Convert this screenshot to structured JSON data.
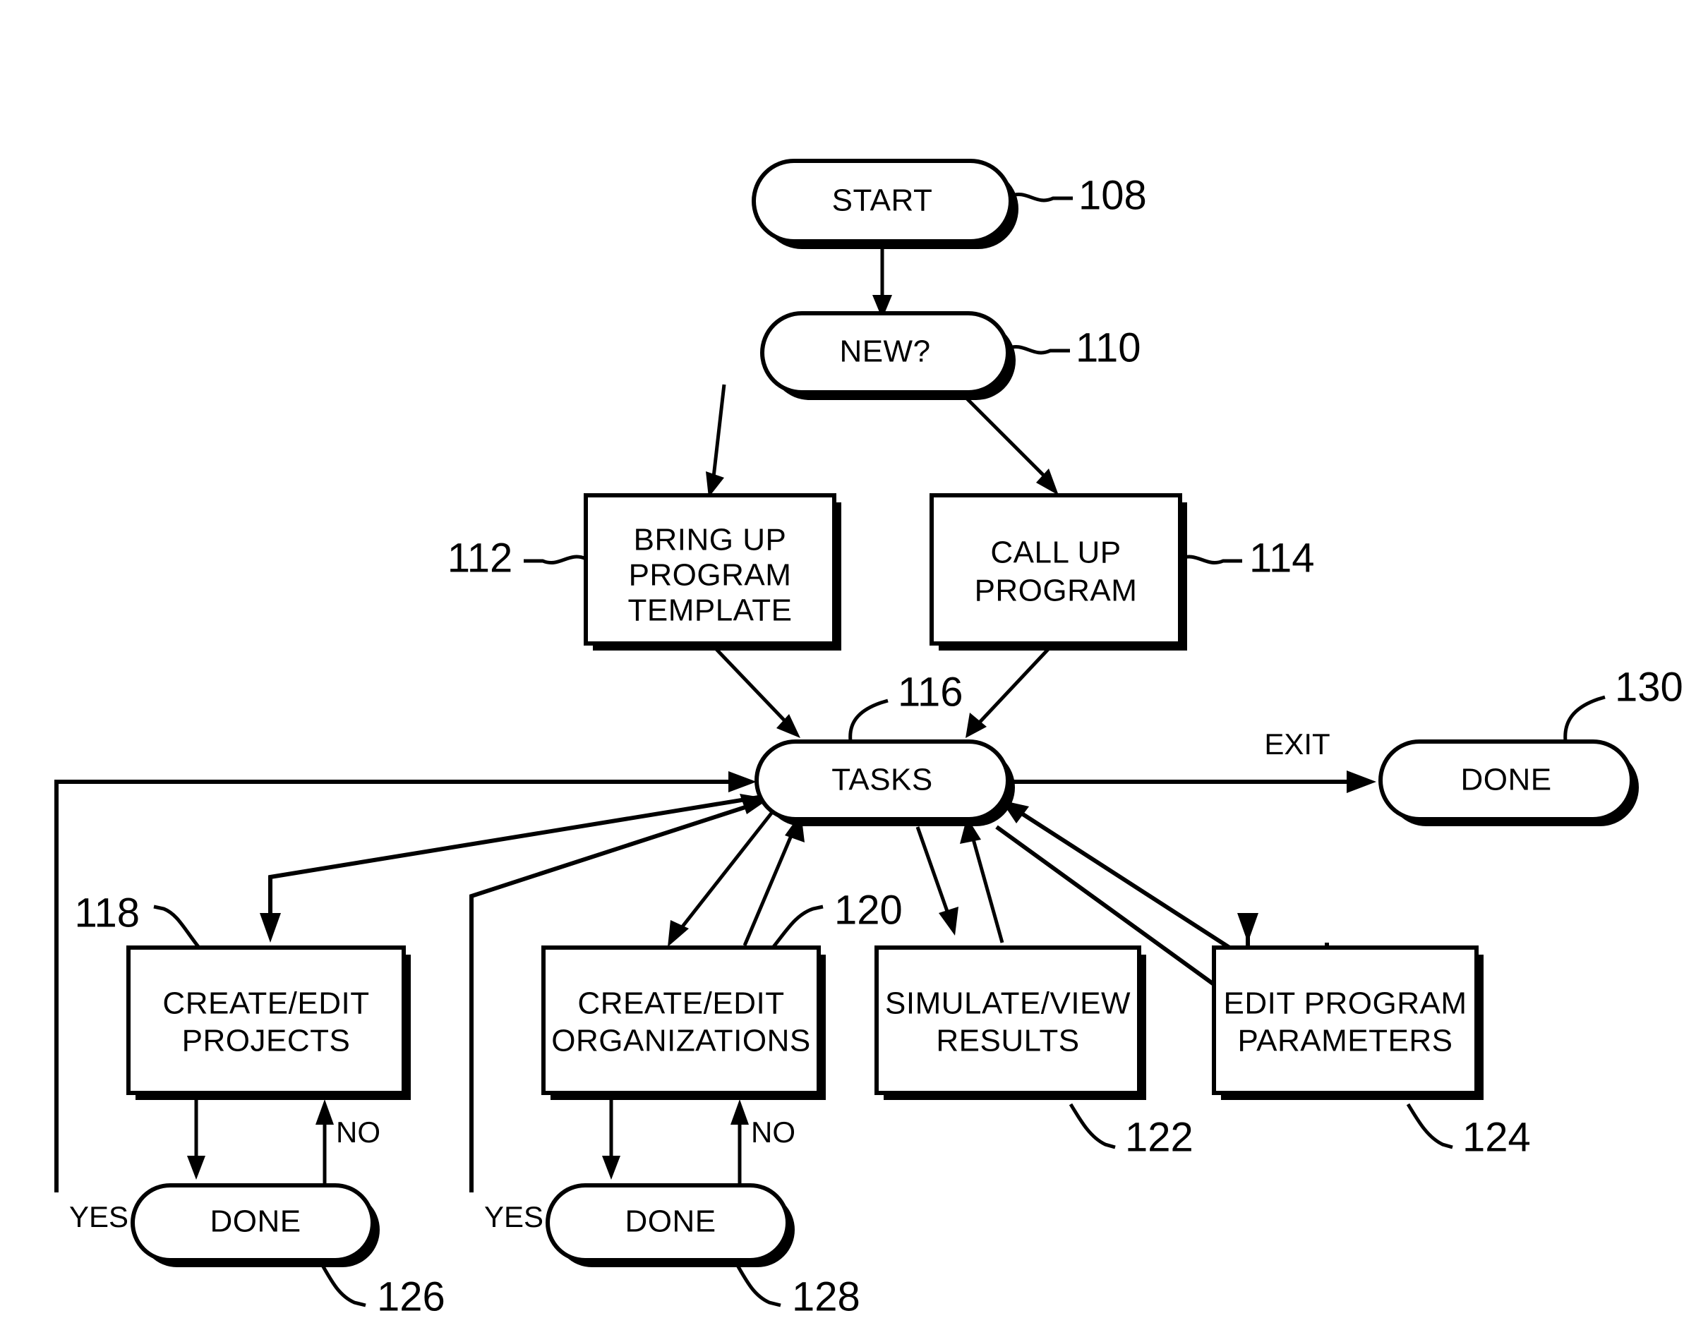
{
  "diagram": {
    "title": "Program workflow flowchart",
    "background_color": "#ffffff",
    "line_color": "#000000"
  },
  "nodes": {
    "start": {
      "label": "START",
      "ref": "108",
      "shape": "stadium"
    },
    "new": {
      "label": "NEW?",
      "ref": "110",
      "shape": "stadium"
    },
    "bring_up": {
      "label_l1": "BRING UP",
      "label_l2": "PROGRAM",
      "label_l3": "TEMPLATE",
      "ref": "112",
      "shape": "rect"
    },
    "call_up": {
      "label_l1": "CALL UP",
      "label_l2": "PROGRAM",
      "ref": "114",
      "shape": "rect"
    },
    "tasks": {
      "label": "TASKS",
      "ref": "116",
      "shape": "stadium"
    },
    "projects": {
      "label_l1": "CREATE/EDIT",
      "label_l2": "PROJECTS",
      "ref": "118",
      "shape": "rect"
    },
    "orgs": {
      "label_l1": "CREATE/EDIT",
      "label_l2": "ORGANIZATIONS",
      "ref": "120",
      "shape": "rect"
    },
    "simulate": {
      "label_l1": "SIMULATE/VIEW",
      "label_l2": "RESULTS",
      "ref": "122",
      "shape": "rect"
    },
    "params": {
      "label_l1": "EDIT PROGRAM",
      "label_l2": "PARAMETERS",
      "ref": "124",
      "shape": "rect"
    },
    "done_proj": {
      "label": "DONE",
      "ref": "126",
      "shape": "stadium"
    },
    "done_orgs": {
      "label": "DONE",
      "ref": "128",
      "shape": "stadium"
    },
    "done_exit": {
      "label": "DONE",
      "ref": "130",
      "shape": "stadium"
    }
  },
  "edge_labels": {
    "exit": "EXIT",
    "yes_proj": "YES",
    "no_proj": "NO",
    "yes_orgs": "YES",
    "no_orgs": "NO"
  },
  "chart_data": {
    "type": "flowchart",
    "title": "Program workflow flowchart",
    "nodes": [
      {
        "id": "108",
        "text": "START",
        "shape": "terminator"
      },
      {
        "id": "110",
        "text": "NEW?",
        "shape": "terminator"
      },
      {
        "id": "112",
        "text": "BRING UP PROGRAM TEMPLATE",
        "shape": "process"
      },
      {
        "id": "114",
        "text": "CALL UP PROGRAM",
        "shape": "process"
      },
      {
        "id": "116",
        "text": "TASKS",
        "shape": "terminator"
      },
      {
        "id": "118",
        "text": "CREATE/EDIT PROJECTS",
        "shape": "process"
      },
      {
        "id": "120",
        "text": "CREATE/EDIT ORGANIZATIONS",
        "shape": "process"
      },
      {
        "id": "122",
        "text": "SIMULATE/VIEW RESULTS",
        "shape": "process"
      },
      {
        "id": "124",
        "text": "EDIT PROGRAM PARAMETERS",
        "shape": "process"
      },
      {
        "id": "126",
        "text": "DONE",
        "shape": "terminator"
      },
      {
        "id": "128",
        "text": "DONE",
        "shape": "terminator"
      },
      {
        "id": "130",
        "text": "DONE",
        "shape": "terminator"
      }
    ],
    "edges": [
      {
        "from": "108",
        "to": "110",
        "label": ""
      },
      {
        "from": "110",
        "to": "112",
        "label": ""
      },
      {
        "from": "110",
        "to": "114",
        "label": ""
      },
      {
        "from": "112",
        "to": "116",
        "label": ""
      },
      {
        "from": "114",
        "to": "116",
        "label": ""
      },
      {
        "from": "116",
        "to": "130",
        "label": "EXIT"
      },
      {
        "from": "116",
        "to": "118",
        "label": ""
      },
      {
        "from": "116",
        "to": "120",
        "label": ""
      },
      {
        "from": "116",
        "to": "122",
        "label": ""
      },
      {
        "from": "116",
        "to": "124",
        "label": ""
      },
      {
        "from": "118",
        "to": "126",
        "label": ""
      },
      {
        "from": "126",
        "to": "118",
        "label": "NO"
      },
      {
        "from": "126",
        "to": "116",
        "label": "YES"
      },
      {
        "from": "120",
        "to": "128",
        "label": ""
      },
      {
        "from": "128",
        "to": "120",
        "label": "NO"
      },
      {
        "from": "128",
        "to": "116",
        "label": "YES"
      },
      {
        "from": "122",
        "to": "116",
        "label": ""
      },
      {
        "from": "124",
        "to": "116",
        "label": ""
      }
    ]
  }
}
